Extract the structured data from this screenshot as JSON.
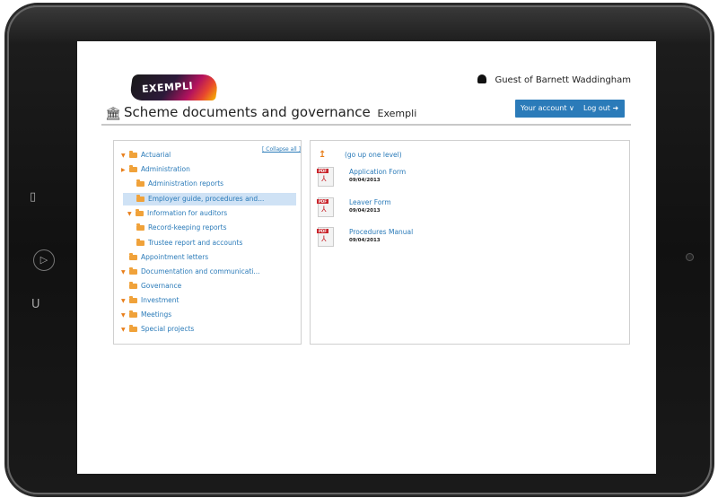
{
  "logo_text": "EXEMPLI",
  "user": {
    "label": "Guest of Barnett Waddingham"
  },
  "title": {
    "main": "Scheme documents and governance",
    "sub": "Exempli"
  },
  "buttons": {
    "account": "Your account ∨",
    "logout": "Log out ➜"
  },
  "tree": {
    "collapse_label": "[ Collapse all ]",
    "items": [
      {
        "label": "Actuarial",
        "caret": "▼"
      },
      {
        "label": "Administration",
        "caret": "▶"
      },
      {
        "label": "Administration reports",
        "caret": ""
      },
      {
        "label": "Employer guide, procedures and...",
        "caret": ""
      },
      {
        "label": "Information for auditors",
        "caret": "▼"
      },
      {
        "label": "Record-keeping reports",
        "caret": ""
      },
      {
        "label": "Trustee report and accounts",
        "caret": ""
      },
      {
        "label": "Appointment letters",
        "caret": ""
      },
      {
        "label": "Documentation and communicati...",
        "caret": "▼"
      },
      {
        "label": "Governance",
        "caret": ""
      },
      {
        "label": "Investment",
        "caret": "▼"
      },
      {
        "label": "Meetings",
        "caret": "▼"
      },
      {
        "label": "Special projects",
        "caret": "▼"
      }
    ]
  },
  "files": {
    "up_label": "(go up one level)",
    "up_arrow": "↥",
    "items": [
      {
        "name": "Application Form",
        "date": "09/04/2013",
        "tag": "PDF"
      },
      {
        "name": "Leaver Form",
        "date": "09/04/2013",
        "tag": "PDF"
      },
      {
        "name": "Procedures Manual",
        "date": "09/04/2013",
        "tag": "PDF"
      }
    ]
  },
  "device_icons": {
    "left_top": "square-icon",
    "home": "home-button",
    "left_bottom": "u-icon",
    "camera": "camera-icon"
  }
}
